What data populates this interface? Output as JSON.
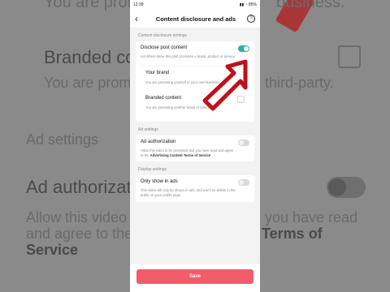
{
  "background": {
    "line1": "You are promo",
    "line1_end": "business.",
    "branded_content": "Branded co",
    "promo_line": "You are promo",
    "promo_line_end": "third-party.",
    "ad_settings": "Ad settings",
    "ad_authorization": "Ad authorizatio",
    "allow_line1": "Allow this video t",
    "allow_line1_end": "you have read",
    "allow_line2": "and agree to the",
    "allow_line2_end": "Terms of",
    "allow_line3": "Service"
  },
  "status_bar": {
    "time": "12:39",
    "icons": "▮▮ ◔ 85%"
  },
  "header": {
    "title": "Content disclosure and ads",
    "back_icon": "‹",
    "help_icon": "?"
  },
  "content_disclosure": {
    "section_label": "Content disclosure settings",
    "disclose": {
      "title": "Disclose post content",
      "description": "Let others know this post promotes a brand, product or service.",
      "enabled": true
    },
    "your_brand": {
      "title": "Your brand",
      "description": "You are promoting yourself or your own business."
    },
    "branded_content": {
      "title": "Branded content",
      "description": "You are promoting another brand or third party."
    }
  },
  "ad_settings": {
    "section_label": "Ad settings",
    "ad_authorization": {
      "title": "Ad authorization",
      "description_pre": "Allow this video to be promoted and you have read and agree to the ",
      "description_link": "Advertising Content Terms of Service",
      "enabled": false
    }
  },
  "display_settings": {
    "section_label": "Display settings",
    "only_show_in_ads": {
      "title": "Only show in ads",
      "description": "This video will only be shown in ads, and won't be visible to the public on your profile page.",
      "enabled": false
    }
  },
  "footer": {
    "save_label": "Save"
  },
  "colors": {
    "toggle_on": "#2bb3a0",
    "save_button": "#f25c6b",
    "arrow": "#c0101a"
  }
}
